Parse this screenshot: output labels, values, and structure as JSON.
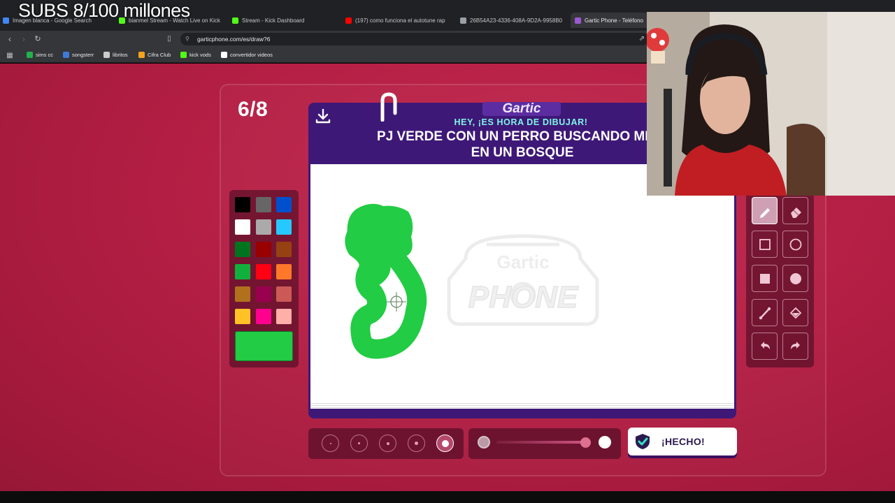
{
  "overlay": {
    "title": "SUBS 8/100 millones"
  },
  "browser": {
    "tabs": [
      {
        "label": "Imagen blanca - Google Search",
        "color": "#4285f4"
      },
      {
        "label": "bianmel Stream - Watch Live on Kick",
        "color": "#53fc18"
      },
      {
        "label": "Stream - Kick Dashboard",
        "color": "#53fc18"
      },
      {
        "label": "(197) como funciona el autotune rap",
        "color": "#ff0000"
      },
      {
        "label": "26B54A23-4336-408A-9D2A-9958B0",
        "color": "#9aa0a6"
      },
      {
        "label": "Gartic Phone - Teléfono",
        "color": "#9b59d0"
      }
    ],
    "url": "garticphone.com/es/draw?6",
    "bookmarks": [
      {
        "label": "sims cc",
        "color": "#22b14c"
      },
      {
        "label": "songsterr",
        "color": "#3d7bd8"
      },
      {
        "label": "libritos",
        "color": "#cccccc"
      },
      {
        "label": "Cifra Club",
        "color": "#f7a21b"
      },
      {
        "label": "kick vods",
        "color": "#53fc18"
      },
      {
        "label": "convertidor videos",
        "color": "#ffffff"
      }
    ]
  },
  "game": {
    "round": "6/8",
    "logo": "Gartic",
    "subtitle": "HEY, ¡ES HORA DE DIBUJAR!",
    "prompt_line1": "PJ VERDE CON UN PERRO BUSCANDO MINA",
    "prompt_line2": "EN UN BOSQUE",
    "watermark_top": "Gartic",
    "watermark_bottom": "PHONE",
    "done_label": "¡HECHO!",
    "selected_color": "#22cc44",
    "selected_tool": "pencil",
    "selected_size_index": 4,
    "palette": [
      "#000000",
      "#666666",
      "#0050cd",
      "#ffffff",
      "#aaaaaa",
      "#26c9ff",
      "#017420",
      "#990000",
      "#964112",
      "#11b03c",
      "#ff0013",
      "#ff7829",
      "#b0701c",
      "#99004e",
      "#cb5a57",
      "#ffc126",
      "#ff008f",
      "#feafa8"
    ],
    "tools": [
      "pencil-icon",
      "eraser-icon",
      "rect-outline-icon",
      "ellipse-outline-icon",
      "rect-filled-icon",
      "ellipse-filled-icon",
      "line-icon",
      "fill-bucket-icon",
      "undo-icon",
      "redo-icon"
    ]
  }
}
